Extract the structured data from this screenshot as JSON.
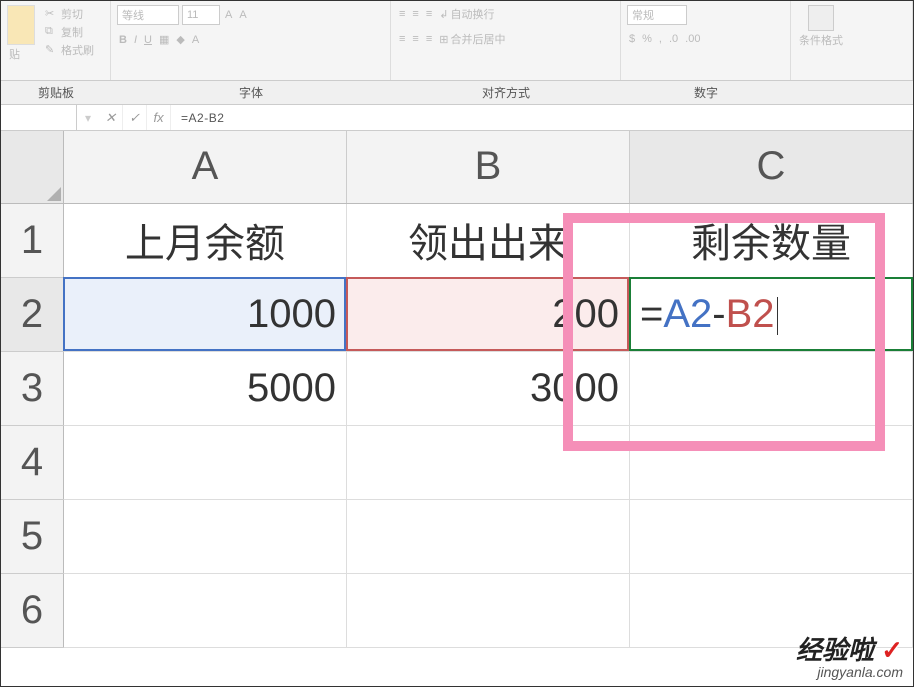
{
  "ribbon": {
    "clipboard": {
      "cut": "剪切",
      "copy": "复制",
      "format_painter": "格式刷",
      "paste": "贴"
    },
    "font": {
      "name": "等线",
      "size": "11",
      "bold": "B",
      "italic": "I",
      "underline": "U"
    },
    "alignment": {
      "wrap_text": "自动换行",
      "merge_center": "合并后居中"
    },
    "number": {
      "format": "常规"
    },
    "styles": {
      "cond_fmt": "条件格式"
    },
    "groups": {
      "clipboard": "剪贴板",
      "font": "字体",
      "alignment": "对齐方式",
      "number": "数字"
    }
  },
  "formula_bar": {
    "name_box": "",
    "cancel": "✕",
    "enter": "✓",
    "fx": "fx",
    "formula": "=A2-B2"
  },
  "columns": [
    "A",
    "B",
    "C"
  ],
  "rows": [
    "1",
    "2",
    "3",
    "4",
    "5",
    "6"
  ],
  "cells": {
    "A1": "上月余额",
    "B1": "领出出来",
    "C1": "剩余数量",
    "A2": "1000",
    "B2": "200",
    "A3": "5000",
    "B3": "3000"
  },
  "editing_cell": {
    "eq": "=",
    "ref1": "A2",
    "minus": "-",
    "ref2": "B2"
  },
  "watermark": {
    "line1": "经验啦",
    "check": "✓",
    "line2": "jingyanla.com"
  }
}
